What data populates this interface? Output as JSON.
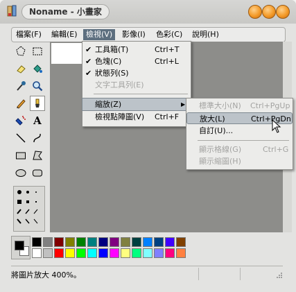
{
  "window": {
    "title": "Noname - 小畫家"
  },
  "menubar": {
    "items": [
      {
        "label": "檔案(F)"
      },
      {
        "label": "編輯(E)"
      },
      {
        "label": "檢視(V)"
      },
      {
        "label": "影像(I)"
      },
      {
        "label": "色彩(C)"
      },
      {
        "label": "說明(H)"
      }
    ]
  },
  "view_menu": {
    "items": [
      {
        "label": "工具箱(T)",
        "shortcut": "Ctrl+T",
        "checked": "✔"
      },
      {
        "label": "色塊(C)",
        "shortcut": "Ctrl+L",
        "checked": "✔"
      },
      {
        "label": "狀態列(S)",
        "shortcut": "",
        "checked": "✔"
      },
      {
        "label": "文字工具列(E)",
        "shortcut": ""
      },
      {
        "label": "縮放(Z)",
        "shortcut": ""
      },
      {
        "label": "檢視點陣圖(V)",
        "shortcut": "Ctrl+F"
      }
    ],
    "submenu_arrow": "▶"
  },
  "zoom_submenu": {
    "items": [
      {
        "label": "標準大小(N)",
        "shortcut": "Ctrl+PgUp"
      },
      {
        "label": "放大(L)",
        "shortcut": "Ctrl+PgDn"
      },
      {
        "label": "自訂(U)...",
        "shortcut": ""
      },
      {
        "label": "顯示格線(G)",
        "shortcut": "Ctrl+G"
      },
      {
        "label": "顯示縮圖(H)",
        "shortcut": ""
      }
    ]
  },
  "palette": {
    "row1": [
      "#000000",
      "#808080",
      "#800000",
      "#808000",
      "#008000",
      "#008080",
      "#000080",
      "#800080",
      "#808040",
      "#004040",
      "#0080ff",
      "#004080",
      "#4000ff",
      "#804000"
    ],
    "row2": [
      "#ffffff",
      "#c0c0c0",
      "#ff0000",
      "#ffff00",
      "#00ff00",
      "#00ffff",
      "#0000ff",
      "#ff00ff",
      "#ffff80",
      "#00ff80",
      "#80ffff",
      "#8080ff",
      "#ff0080",
      "#ff8040"
    ],
    "fg": "#000000",
    "bg": "#ffffff"
  },
  "status": {
    "text": "將圖片放大 400%。"
  },
  "colors": {
    "accent": "#f39a28",
    "menu_highlight": "#5d6f7f"
  }
}
